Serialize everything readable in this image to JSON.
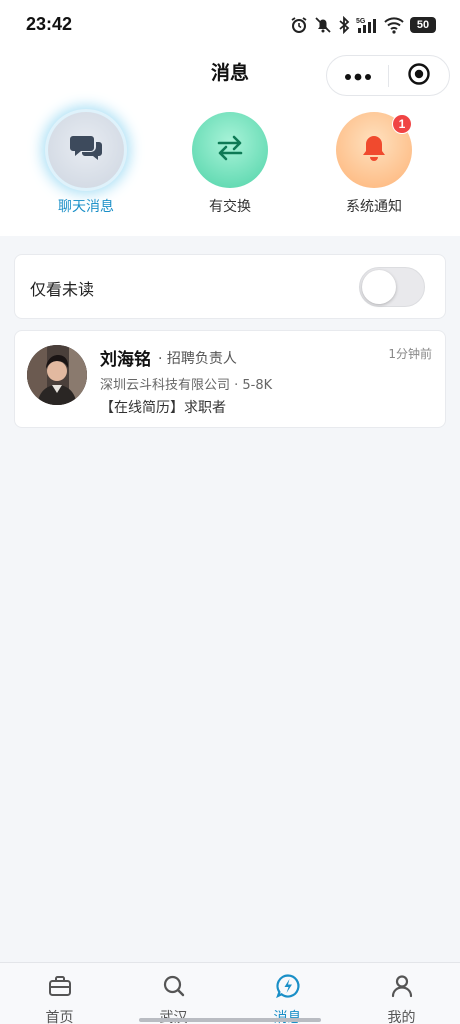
{
  "status_bar": {
    "time": "23:42",
    "battery": "50",
    "icons": [
      "alarm-icon",
      "mute-icon",
      "bluetooth-icon",
      "signal-5g-icon",
      "wifi-icon",
      "battery-icon"
    ]
  },
  "header": {
    "title": "消息",
    "capsule": {
      "more_icon": "more-icon",
      "close_icon": "record-icon"
    }
  },
  "categories": [
    {
      "label": "聊天消息",
      "icon": "chat-bubbles-icon",
      "active": true
    },
    {
      "label": "有交换",
      "icon": "swap-arrows-icon",
      "active": false
    },
    {
      "label": "系统通知",
      "icon": "bell-icon",
      "badge": "1",
      "active": false
    }
  ],
  "filter": {
    "label": "仅看未读",
    "toggle_on": false
  },
  "messages": [
    {
      "name": "刘海铭",
      "role": "· 招聘负责人",
      "time": "1分钟前",
      "company": "深圳云斗科技有限公司 · 5-8K",
      "preview": "【在线简历】求职者"
    }
  ],
  "tabbar": [
    {
      "label": "首页",
      "icon": "briefcase-icon",
      "active": false
    },
    {
      "label": "武汉",
      "icon": "search-icon",
      "active": false
    },
    {
      "label": "消息",
      "icon": "message-bolt-icon",
      "active": true
    },
    {
      "label": "我的",
      "icon": "person-icon",
      "active": false
    }
  ],
  "colors": {
    "accent": "#1a8fc7",
    "badge": "#f04444",
    "background": "#f4f6f9"
  }
}
